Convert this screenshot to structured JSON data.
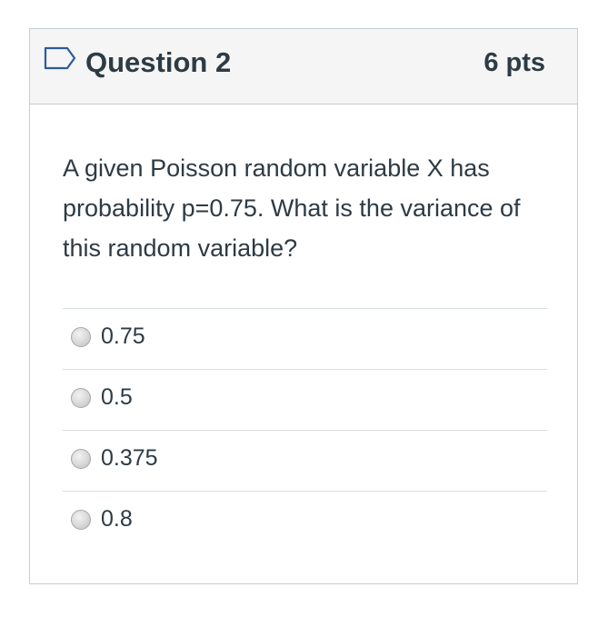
{
  "question": {
    "title": "Question 2",
    "points": "6 pts",
    "text": "A given Poisson random variable X has probability p=0.75. What is the variance of this random variable?",
    "flag_icon": "flag-outline-icon"
  },
  "answers": [
    {
      "label": "0.75",
      "selected": false
    },
    {
      "label": "0.5",
      "selected": false
    },
    {
      "label": "0.375",
      "selected": false
    },
    {
      "label": "0.8",
      "selected": false
    }
  ],
  "colors": {
    "text": "#2d3b45",
    "header_bg": "#f5f5f5",
    "border": "#c7cdd1",
    "flag_stroke": "#2d5b9a"
  }
}
